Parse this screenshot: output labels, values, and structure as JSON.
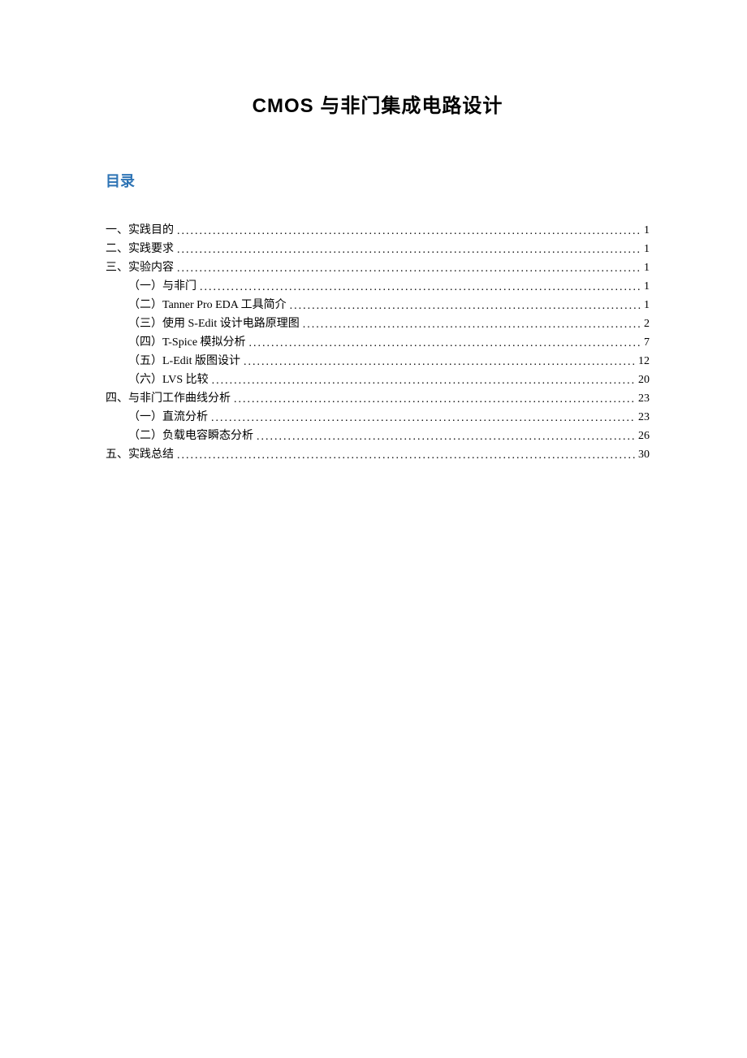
{
  "title": "CMOS 与非门集成电路设计",
  "toc_heading": "目录",
  "toc": [
    {
      "level": 1,
      "label": "一、实践目的",
      "page": "1"
    },
    {
      "level": 1,
      "label": "二、实践要求",
      "page": "1"
    },
    {
      "level": 1,
      "label": "三、实验内容",
      "page": "1"
    },
    {
      "level": 2,
      "label": "（一）与非门",
      "page": "1"
    },
    {
      "level": 2,
      "label": "（二）Tanner Pro EDA 工具简介",
      "page": "1"
    },
    {
      "level": 2,
      "label": "（三）使用 S-Edit 设计电路原理图",
      "page": "2"
    },
    {
      "level": 2,
      "label": "（四）T-Spice 模拟分析",
      "page": "7"
    },
    {
      "level": 2,
      "label": "（五）L-Edit 版图设计",
      "page": "12"
    },
    {
      "level": 2,
      "label": "（六）LVS 比较",
      "page": "20"
    },
    {
      "level": 1,
      "label": "四、与非门工作曲线分析",
      "page": "23"
    },
    {
      "level": 2,
      "label": "（一）直流分析",
      "page": "23"
    },
    {
      "level": 2,
      "label": "（二）负载电容瞬态分析",
      "page": "26"
    },
    {
      "level": 1,
      "label": "五、实践总结",
      "page": "30"
    }
  ]
}
